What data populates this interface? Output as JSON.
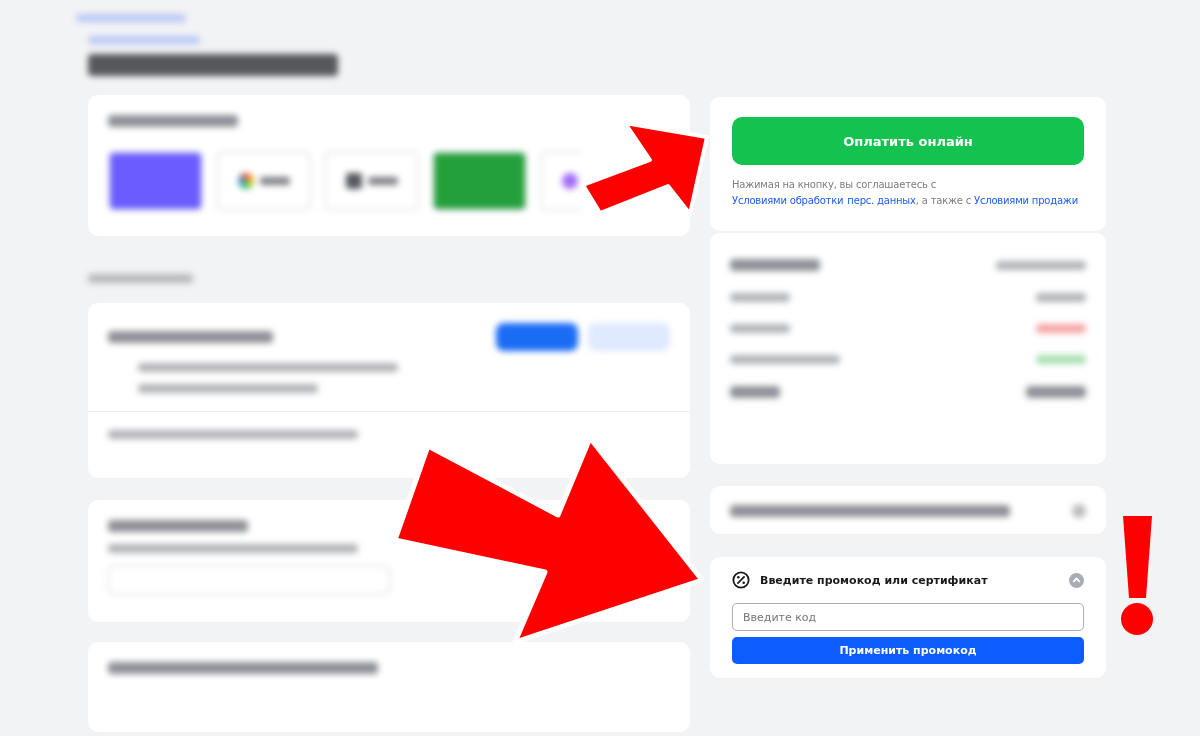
{
  "pay_panel": {
    "button": "Оплатить онлайн",
    "consent": [
      {
        "kind": "text",
        "text": "Нажимая на кнопку, вы соглашаетесь с "
      },
      {
        "kind": "link",
        "text": "Условиями обработки"
      },
      {
        "kind": "link",
        "text": "перс. данных"
      },
      {
        "kind": "text",
        "text": ", а также с "
      },
      {
        "kind": "link",
        "text": "Условиями продажи"
      }
    ]
  },
  "promo": {
    "title": "Введите промокод или сертификат",
    "expanded": true,
    "placeholder": "Введите код",
    "button": "Применить промокод"
  }
}
